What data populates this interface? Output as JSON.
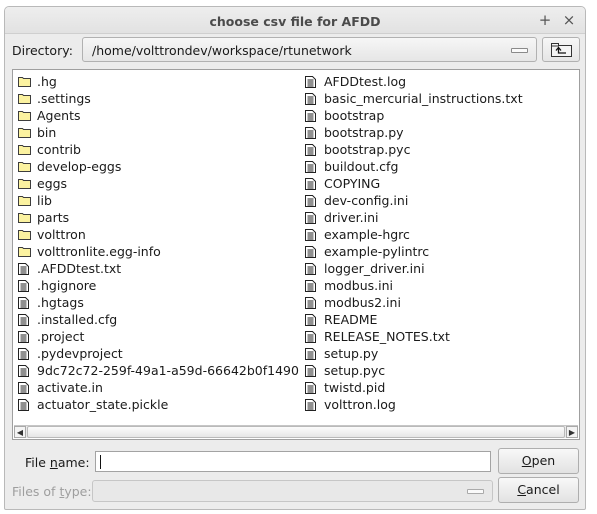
{
  "window": {
    "title": "choose csv file for AFDD",
    "maximize_glyph": "+",
    "close_glyph": "×"
  },
  "directory": {
    "label": "Directory:",
    "path": "/home/volttrondev/workspace/rtunetwork",
    "up_icon": "up-folder-icon"
  },
  "files_left": [
    {
      "name": ".hg",
      "type": "folder"
    },
    {
      "name": ".settings",
      "type": "folder"
    },
    {
      "name": "Agents",
      "type": "folder"
    },
    {
      "name": "bin",
      "type": "folder"
    },
    {
      "name": "contrib",
      "type": "folder"
    },
    {
      "name": "develop-eggs",
      "type": "folder"
    },
    {
      "name": "eggs",
      "type": "folder"
    },
    {
      "name": "lib",
      "type": "folder"
    },
    {
      "name": "parts",
      "type": "folder"
    },
    {
      "name": "volttron",
      "type": "folder"
    },
    {
      "name": "volttronlite.egg-info",
      "type": "folder"
    },
    {
      "name": ".AFDDtest.txt",
      "type": "file"
    },
    {
      "name": ".hgignore",
      "type": "file"
    },
    {
      "name": ".hgtags",
      "type": "file"
    },
    {
      "name": ".installed.cfg",
      "type": "file"
    },
    {
      "name": ".project",
      "type": "file"
    },
    {
      "name": ".pydevproject",
      "type": "file"
    },
    {
      "name": "9dc72c72-259f-49a1-a59d-66642b0f1490",
      "type": "file"
    },
    {
      "name": "activate.in",
      "type": "file"
    },
    {
      "name": "actuator_state.pickle",
      "type": "file"
    }
  ],
  "files_right": [
    {
      "name": "AFDDtest.log",
      "type": "file"
    },
    {
      "name": "basic_mercurial_instructions.txt",
      "type": "file"
    },
    {
      "name": "bootstrap",
      "type": "file"
    },
    {
      "name": "bootstrap.py",
      "type": "file"
    },
    {
      "name": "bootstrap.pyc",
      "type": "file"
    },
    {
      "name": "buildout.cfg",
      "type": "file"
    },
    {
      "name": "COPYING",
      "type": "file"
    },
    {
      "name": "dev-config.ini",
      "type": "file"
    },
    {
      "name": "driver.ini",
      "type": "file"
    },
    {
      "name": "example-hgrc",
      "type": "file"
    },
    {
      "name": "example-pylintrc",
      "type": "file"
    },
    {
      "name": "logger_driver.ini",
      "type": "file"
    },
    {
      "name": "modbus.ini",
      "type": "file"
    },
    {
      "name": "modbus2.ini",
      "type": "file"
    },
    {
      "name": "README",
      "type": "file"
    },
    {
      "name": "RELEASE_NOTES.txt",
      "type": "file"
    },
    {
      "name": "setup.py",
      "type": "file"
    },
    {
      "name": "setup.pyc",
      "type": "file"
    },
    {
      "name": "twistd.pid",
      "type": "file"
    },
    {
      "name": "volttron.log",
      "type": "file"
    }
  ],
  "scrollbar": {
    "left_arrow": "◀",
    "right_arrow": "▶"
  },
  "file_name": {
    "label_pre": "File ",
    "label_mnemonic": "n",
    "label_post": "ame:",
    "value": ""
  },
  "files_of_type": {
    "label_pre": "Files of ",
    "label_mnemonic": "t",
    "label_post": "ype:",
    "value": "",
    "enabled": false
  },
  "buttons": {
    "open_mnemonic": "O",
    "open_rest": "pen",
    "cancel_mnemonic": "C",
    "cancel_rest": "ancel"
  },
  "colors": {
    "folder_fill": "#fbf2a0",
    "folder_stroke": "#3d3d3d",
    "file_stroke": "#222222"
  }
}
